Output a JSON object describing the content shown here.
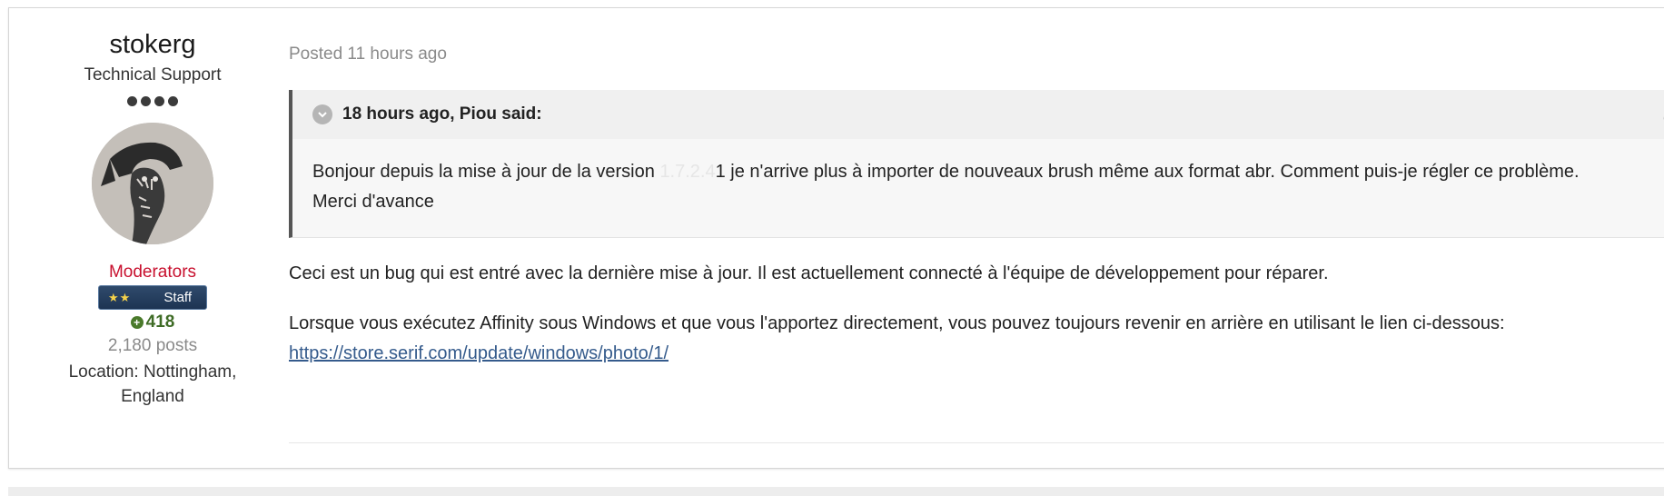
{
  "author": {
    "name": "stokerg",
    "title": "Technical Support",
    "rank_dots": 4,
    "group": "Moderators",
    "badge_label": "Staff",
    "badge_stars": "★★",
    "reputation": "418",
    "posts": "2,180 posts",
    "location": "Location: Nottingham, England"
  },
  "post": {
    "posted_time": "Posted 11 hours ago",
    "quote": {
      "citation": "18 hours ago, Piou said:",
      "text_before": "Bonjour depuis la mise à jour de la version ",
      "text_obscured": "1.7.2.4",
      "text_after": "1 je n'arrive plus à importer de nouveaux brush même aux format abr. Comment puis-je régler ce problème.",
      "text_line2": "Merci d'avance"
    },
    "reply": {
      "paragraph1": "Ceci est un bug qui est entré avec la dernière mise à jour. Il est actuellement connecté à l'équipe de développement pour réparer.",
      "paragraph2": "Lorsque vous exécutez Affinity sous Windows et que vous l'apportez directement, vous pouvez toujours revenir en arrière en utilisant le lien ci-dessous: ",
      "link_text": "https://store.serif.com/update/windows/photo/1/"
    }
  },
  "colors": {
    "group": "#c8102e",
    "reputation": "#3e6b25",
    "link": "#355b8c"
  }
}
